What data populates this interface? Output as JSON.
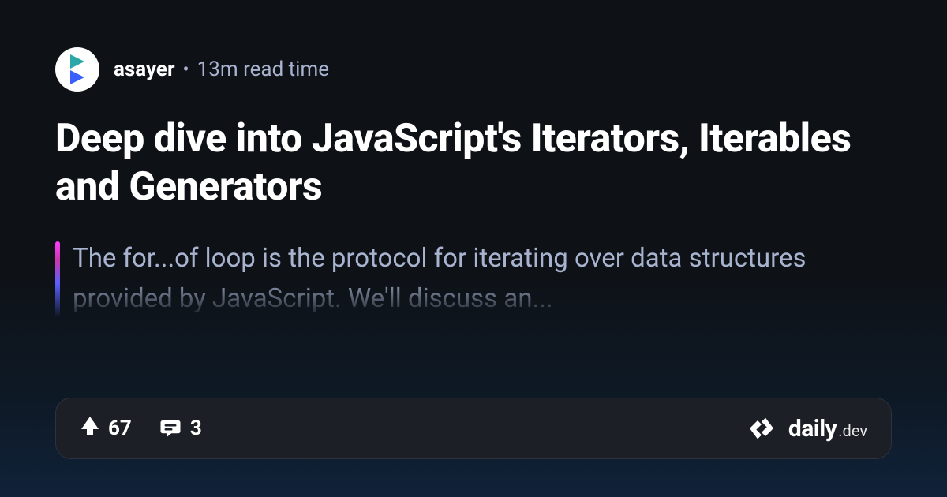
{
  "header": {
    "author": "asayer",
    "separator": "•",
    "read_time": "13m read time"
  },
  "title": "Deep dive into JavaScript's Iterators, Iterables and Generators",
  "excerpt": "The for...of loop is the protocol for iterating over data structures provided by JavaScript. We'll discuss an...",
  "footer": {
    "upvotes": "67",
    "comments": "3",
    "brand_main": "daily",
    "brand_sub": ".dev"
  }
}
